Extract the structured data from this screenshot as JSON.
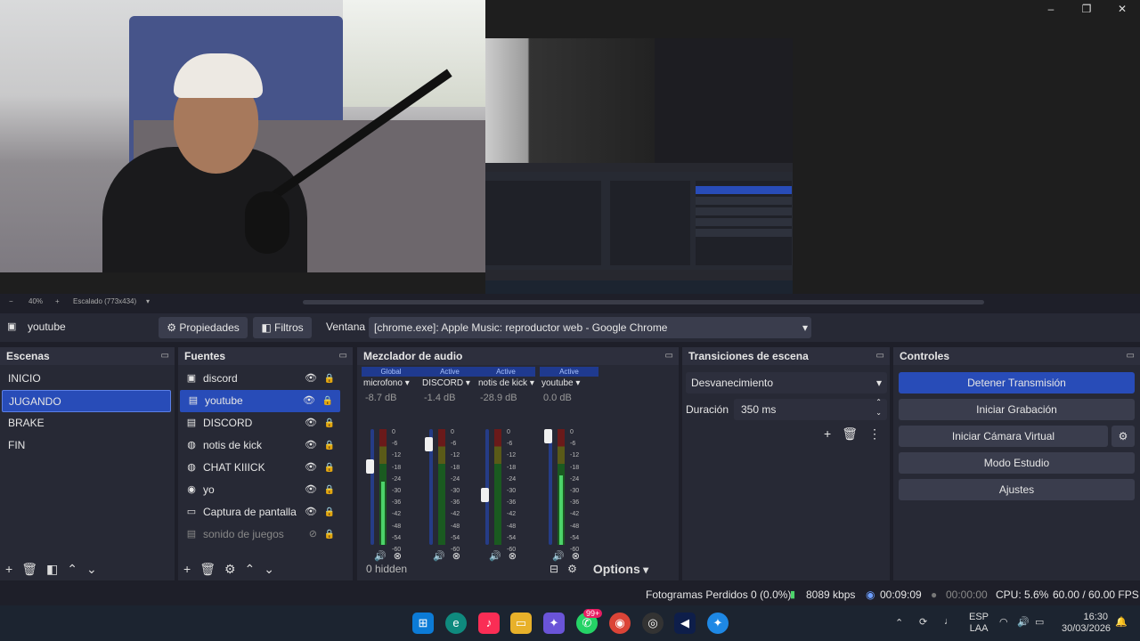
{
  "window": {
    "minimize": "–",
    "maximize": "❐",
    "close": "✕"
  },
  "preview": {
    "zoom": "40%",
    "minus": "−",
    "plus": "+",
    "scaled": "Escalado (773x434)",
    "scale_caret": "▾"
  },
  "source_toolbar": {
    "source_name": "youtube",
    "properties": "Propiedades",
    "filters": "Filtros",
    "window_label": "Ventana",
    "window_value": "[chrome.exe]: Apple Music: reproductor web - Google Chrome"
  },
  "scenes": {
    "title": "Escenas",
    "items": [
      "INICIO",
      "JUGANDO",
      "BRAKE",
      "FIN"
    ],
    "selected": "JUGANDO"
  },
  "sources": {
    "title": "Fuentes",
    "items": [
      {
        "name": "discord",
        "icon": "image-icon"
      },
      {
        "name": "youtube",
        "icon": "window-capture-icon"
      },
      {
        "name": "DISCORD",
        "icon": "window-capture-icon"
      },
      {
        "name": "notis de kick",
        "icon": "browser-icon"
      },
      {
        "name": "CHAT KIIICK",
        "icon": "browser-icon"
      },
      {
        "name": "yo",
        "icon": "camera-icon"
      },
      {
        "name": "Captura de pantalla",
        "icon": "monitor-icon"
      },
      {
        "name": "sonido de juegos",
        "icon": "window-capture-icon"
      }
    ]
  },
  "mixer": {
    "title": "Mezclador de audio",
    "channels": [
      {
        "badge": "Global",
        "name": "microfono",
        "db": "-8.7 dB",
        "level": 0.7,
        "meter": 0.55
      },
      {
        "badge": "Active",
        "name": "DISCORD",
        "db": "-1.4 dB",
        "level": 0.92,
        "meter": 0.0
      },
      {
        "badge": "Active",
        "name": "notis de kick",
        "db": "-28.9 dB",
        "level": 0.42,
        "meter": 0.0
      },
      {
        "badge": "Active",
        "name": "youtube",
        "db": "0.0 dB",
        "level": 1.0,
        "meter": 0.6
      }
    ],
    "scale": [
      "0",
      "-6",
      "-12",
      "-18",
      "-24",
      "-30",
      "-36",
      "-42",
      "-48",
      "-54",
      "-60"
    ],
    "hidden": "0 hidden",
    "options": "Options"
  },
  "transitions": {
    "title": "Transiciones de escena",
    "selected": "Desvanecimiento",
    "duration_label": "Duración",
    "duration_value": "350 ms"
  },
  "controls": {
    "title": "Controles",
    "stop_stream": "Detener Transmisión",
    "start_record": "Iniciar Grabación",
    "virtual_cam": "Iniciar Cámara Virtual",
    "studio_mode": "Modo Estudio",
    "settings": "Ajustes"
  },
  "status": {
    "dropped": "Fotogramas Perdidos 0 (0.0%)",
    "bitrate": "8089 kbps",
    "stream_time": "00:09:09",
    "record_time": "00:00:00",
    "cpu": "CPU: 5.6%",
    "fps": "60.00 / 60.00 FPS"
  },
  "taskbar": {
    "notification_badge": "99+",
    "lang": "ESP",
    "layout": "LAA",
    "time": "16:30",
    "date": "30/03/2026"
  },
  "colors": {
    "accent": "#284cb8",
    "background": "#272935"
  }
}
